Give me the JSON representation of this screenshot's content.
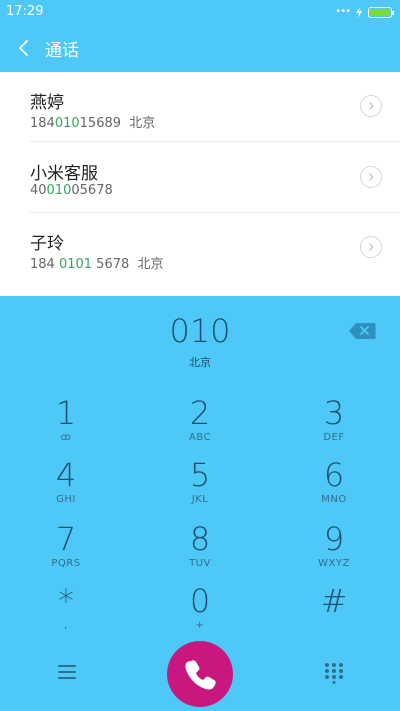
{
  "status": {
    "time": "17:29",
    "dots": "•••"
  },
  "header": {
    "title": "通话"
  },
  "contacts": [
    {
      "name": "燕婷",
      "num_pre": "184",
      "num_hl": "010",
      "num_post": "15689",
      "location": "北京"
    },
    {
      "name": "小米客服",
      "num_pre": "40",
      "num_hl": "010",
      "num_post": "05678",
      "location": ""
    },
    {
      "name": "子玲",
      "num_pre": "184 ",
      "num_hl": "0101",
      "num_post": " 5678",
      "location": "北京"
    }
  ],
  "dialer": {
    "number": "010",
    "location": "北京",
    "keys": [
      {
        "digit": "1",
        "letters": "ꝏ"
      },
      {
        "digit": "2",
        "letters": "ABC"
      },
      {
        "digit": "3",
        "letters": "DEF"
      },
      {
        "digit": "4",
        "letters": "GHI"
      },
      {
        "digit": "5",
        "letters": "JKL"
      },
      {
        "digit": "6",
        "letters": "MNO"
      },
      {
        "digit": "7",
        "letters": "PQRS"
      },
      {
        "digit": "8",
        "letters": "TUV"
      },
      {
        "digit": "9",
        "letters": "WXYZ"
      },
      {
        "digit": "*",
        "letters": ","
      },
      {
        "digit": "0",
        "letters": "+"
      },
      {
        "digit": "#",
        "letters": ""
      }
    ]
  },
  "colors": {
    "accent": "#4ec8f7",
    "highlight": "#2eaa5a",
    "call": "#c8187f",
    "key_text": "#1e4f6e"
  },
  "icons": {
    "back": "chevron-left-icon",
    "backspace": "backspace-icon",
    "menu": "menu-icon",
    "call": "phone-icon",
    "keypad": "dialpad-icon"
  }
}
